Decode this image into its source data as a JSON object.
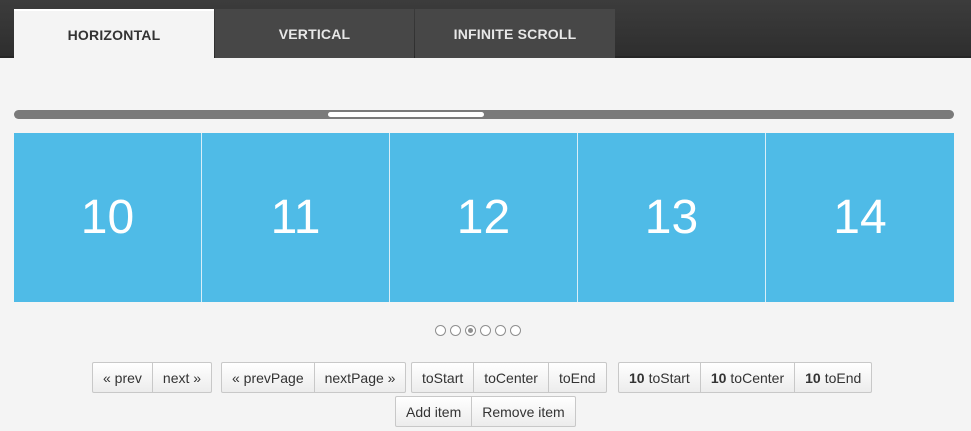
{
  "tabs": [
    {
      "label": "HORIZONTAL",
      "active": true
    },
    {
      "label": "VERTICAL",
      "active": false
    },
    {
      "label": "INFINITE SCROLL",
      "active": false
    }
  ],
  "slides": [
    "10",
    "11",
    "12",
    "13",
    "14"
  ],
  "pager": {
    "count": 6,
    "active_index": 2
  },
  "controls": {
    "prev": "« prev",
    "next": "next »",
    "prevPage": "« prevPage",
    "nextPage": "nextPage »",
    "toStart": "toStart",
    "toCenter": "toCenter",
    "toEnd": "toEnd",
    "item_number": "10",
    "item_toStart": "toStart",
    "item_toCenter": "toCenter",
    "item_toEnd": "toEnd",
    "add_item": "Add item",
    "remove_item": "Remove item"
  },
  "colors": {
    "slide": "#4fbbe7",
    "topbar": "#343434",
    "background": "#f4f4f4"
  }
}
